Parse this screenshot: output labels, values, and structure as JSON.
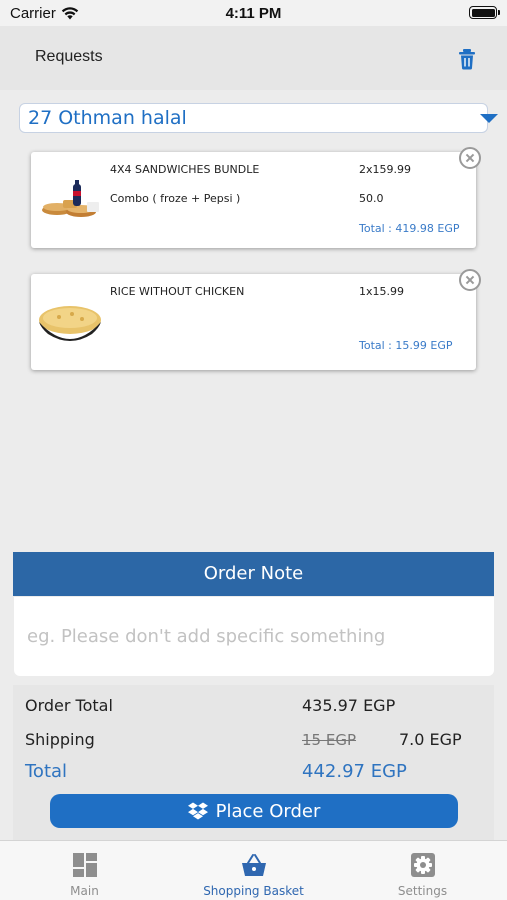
{
  "status_bar": {
    "carrier": "Carrier",
    "time": "4:11 PM"
  },
  "header": {
    "title": "Requests",
    "trash_icon": "trash-icon"
  },
  "branch": {
    "selected": "27 Othman halal"
  },
  "cart_items": [
    {
      "name": "4X4 SANDWICHES BUNDLE",
      "quantity_price": "2x159.99",
      "option": "Combo ( froze + Pepsi )",
      "option_price": "50.0",
      "total": "Total : 419.98 EGP",
      "image_icon": "sandwich-bundle-image"
    },
    {
      "name": "RICE WITHOUT CHICKEN",
      "quantity_price": "1x15.99",
      "total": "Total : 15.99 EGP",
      "image_icon": "rice-bowl-image"
    }
  ],
  "order_note": {
    "title": "Order Note",
    "placeholder": "eg. Please don't add specific something",
    "value": ""
  },
  "summary": {
    "order_total_label": "Order Total",
    "order_total_value": "435.97 EGP",
    "shipping_label": "Shipping",
    "shipping_old_value": "15 EGP",
    "shipping_value": "7.0 EGP",
    "total_label": "Total",
    "total_value": "442.97 EGP"
  },
  "place_order": {
    "label": "Place Order",
    "icon": "dropbox-icon"
  },
  "tabs": [
    {
      "label": "Main",
      "icon": "grid-icon",
      "active": false
    },
    {
      "label": "Shopping Basket",
      "icon": "basket-icon",
      "active": true
    },
    {
      "label": "Settings",
      "icon": "gear-icon",
      "active": false
    }
  ],
  "colors": {
    "accent": "#1f6fc4",
    "note_header": "#2c67a6",
    "background": "#ececec"
  }
}
